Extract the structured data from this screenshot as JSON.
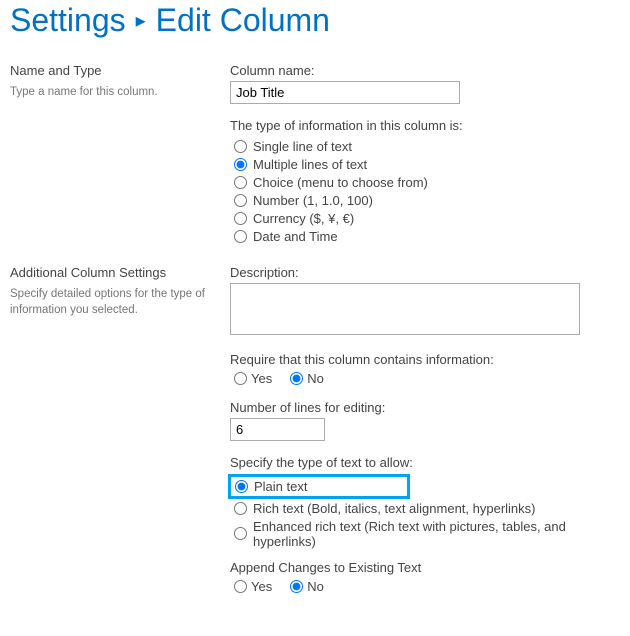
{
  "breadcrumb": {
    "settings": "Settings",
    "current": "Edit Column"
  },
  "nameType": {
    "heading": "Name and Type",
    "desc": "Type a name for this column.",
    "columnNameLabel": "Column name:",
    "columnNameValue": "Job Title",
    "typeInfoLabel": "The type of information in this column is:",
    "types": {
      "single": "Single line of text",
      "multi": "Multiple lines of text",
      "choice": "Choice (menu to choose from)",
      "number": "Number (1, 1.0, 100)",
      "currency": "Currency ($, ¥, €)",
      "datetime": "Date and Time"
    }
  },
  "additional": {
    "heading": "Additional Column Settings",
    "desc": "Specify detailed options for the type of information you selected.",
    "descriptionLabel": "Description:",
    "descriptionValue": "",
    "requireLabel": "Require that this column contains information:",
    "numLinesLabel": "Number of lines for editing:",
    "numLinesValue": "6",
    "textTypeLabel": "Specify the type of text to allow:",
    "textTypes": {
      "plain": "Plain text",
      "rich": "Rich text (Bold, italics, text alignment, hyperlinks)",
      "enhanced": "Enhanced rich text (Rich text with pictures, tables, and hyperlinks)"
    },
    "appendLabel": "Append Changes to Existing Text",
    "yes": "Yes",
    "no": "No"
  }
}
